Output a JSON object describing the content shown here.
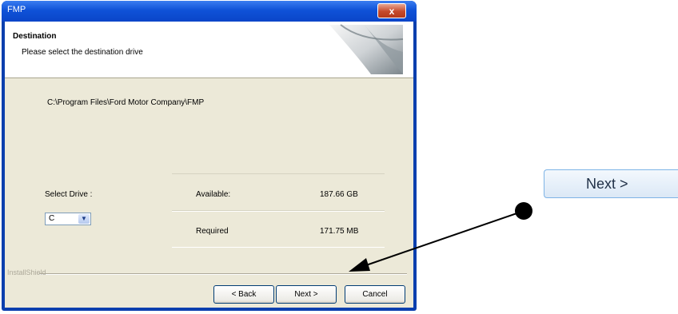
{
  "window": {
    "title": "FMP",
    "close_symbol": "x"
  },
  "header": {
    "title": "Destination",
    "subtitle": "Please select the destination drive"
  },
  "body": {
    "install_path": "C:\\Program Files\\Ford Motor Company\\FMP",
    "select_drive_label": "Select Drive :",
    "drive_value": "C",
    "drive_arrow": "▼",
    "available_label": "Available:",
    "available_value": "187.66 GB",
    "required_label": "Required",
    "required_value": "171.75 MB"
  },
  "footer": {
    "installshield_label": "InstallShield",
    "back_label": "< Back",
    "next_label": "Next >",
    "cancel_label": "Cancel"
  },
  "callout": {
    "button_label": "Next >"
  },
  "icons": {
    "close": "close-icon",
    "header_graphic": "page-curl-icon",
    "dropdown": "chevron-down-icon"
  }
}
